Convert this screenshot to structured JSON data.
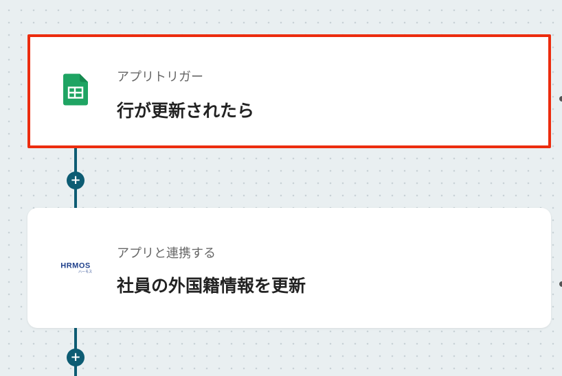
{
  "steps": [
    {
      "subtitle": "アプリトリガー",
      "title": "行が更新されたら",
      "app_icon": "google-sheets-icon",
      "selected": true
    },
    {
      "subtitle": "アプリと連携する",
      "title": "社員の外国籍情報を更新",
      "app_icon": "hrmos-logo",
      "logo_text": "HRMOS",
      "logo_subtext": "ハーモス",
      "selected": false
    }
  ],
  "add_step_symbol": "+",
  "colors": {
    "connector": "#0d5c73",
    "selection_border": "#ec2c0e",
    "sheets_green": "#1fa463",
    "hrmos_blue": "#1e3f8a"
  }
}
